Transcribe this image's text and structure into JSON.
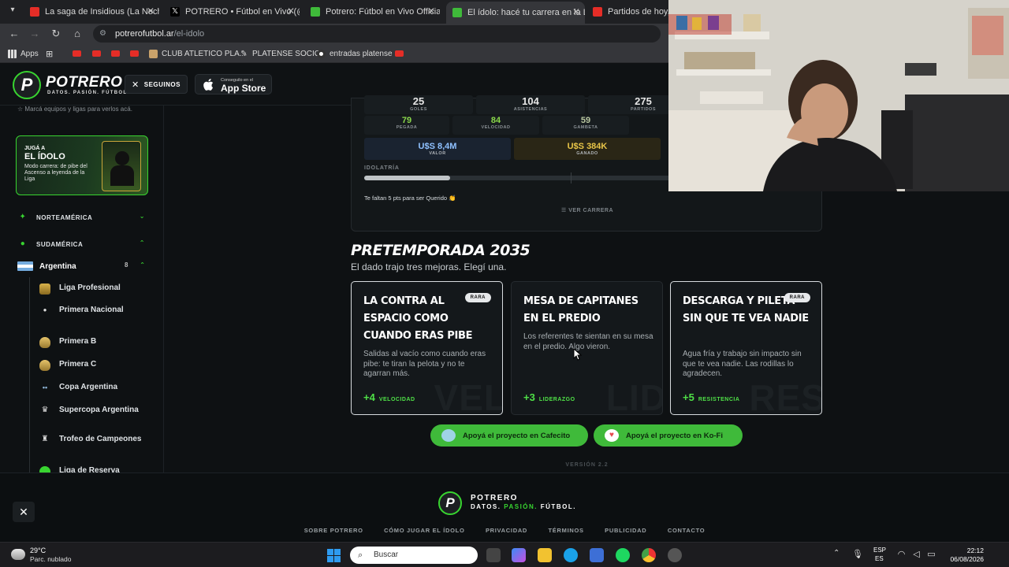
{
  "browser": {
    "tabs": [
      {
        "title": "La saga de Insidious (La Noche",
        "fav_color": "#e52d27"
      },
      {
        "title": "POTRERO • Fútbol en Vivo (@p",
        "fav_color": "#000000"
      },
      {
        "title": "Potrero: Fútbol en Vivo Official",
        "fav_color": "#3fba3a"
      },
      {
        "title": "El ídolo: hacé tu carrera en la L",
        "fav_color": "#3fba3a"
      },
      {
        "title": "Partidos de hoy, resu",
        "fav_color": "#e52d27"
      }
    ],
    "url_domain": "potrerofutbol.ar",
    "url_path": "/el-idolo",
    "bookmarks": [
      "Apps",
      "CLUB ATLETICO PLA...",
      "PLATENSE SOCIO",
      "entradas platense"
    ]
  },
  "header": {
    "logo_letter": "P",
    "logo_name": "POTRERO",
    "logo_tag": "DATOS. PASIÓN. FÚTBOL.",
    "follow_label": "SEGUINOS",
    "appstore_small": "Conseguilo en el",
    "appstore_big": "App Store"
  },
  "sidebar": {
    "hint": "Marcá equipos y ligas para verlos acá.",
    "promo": {
      "kicker": "JUGÁ A",
      "title": "EL ÍDOLO",
      "desc": "Modo carrera: de pibe del Ascenso a leyenda de la Liga"
    },
    "regions": [
      {
        "name": "NORTEAMÉRICA",
        "expanded": false
      },
      {
        "name": "SUDAMÉRICA",
        "expanded": true
      }
    ],
    "country": {
      "name": "Argentina",
      "count": "8"
    },
    "leagues": [
      "Liga Profesional",
      "Primera Nacional",
      "Primera B",
      "Primera C",
      "Copa Argentina",
      "Supercopa Argentina",
      "Trofeo de Campeones",
      "Liga de Reserva"
    ]
  },
  "career": {
    "stats": [
      {
        "value": "25",
        "label": "GOLES"
      },
      {
        "value": "104",
        "label": "ASISTENCIAS"
      },
      {
        "value": "275",
        "label": "PARTIDOS"
      }
    ],
    "attributes": [
      {
        "value": "79",
        "label": "PEGADA"
      },
      {
        "value": "84",
        "label": "VELOCIDAD"
      },
      {
        "value": "59",
        "label": "GAMBETA"
      }
    ],
    "value": {
      "amount": "U$S 8,4M",
      "label": "VALOR"
    },
    "earned": {
      "amount": "U$S 384K",
      "label": "GANADO"
    },
    "idolatry_label": "IDOLATRÍA",
    "idolatry_fraction": 0.28,
    "idolatry_msg": "Te faltan 5 pts para ser Querido 👏",
    "view_career": "VER CARRERA"
  },
  "preseason": {
    "title": "PRETEMPORADA 2035",
    "subtitle": "El dado trajo tres mejoras. Elegí una.",
    "options": [
      {
        "title": "LA CONTRA AL ESPACIO COMO CUANDO ERAS PIBE",
        "badge": "RARA",
        "desc": "Salidas al vacío como cuando eras pibe: te tiran la pelota y no te agarran más.",
        "bonus": "+4",
        "stat": "VELOCIDAD",
        "watermark": "VEL"
      },
      {
        "title": "MESA DE CAPITANES EN EL PREDIO",
        "badge": "",
        "desc": "Los referentes te sientan en su mesa en el predio. Algo vieron.",
        "bonus": "+3",
        "stat": "LIDERAZGO",
        "watermark": "LID"
      },
      {
        "title": "DESCARGA Y PILETA SIN QUE TE VEA NADIE",
        "badge": "RARA",
        "desc": "Agua fría y trabajo sin impacto sin que te vea nadie. Las rodillas lo agradecen.",
        "bonus": "+5",
        "stat": "RESISTENCIA",
        "watermark": "RES"
      }
    ]
  },
  "donate": {
    "cafecito": "Apoyá el proyecto en Cafecito",
    "kofi": "Apoyá el proyecto en Ko-Fi"
  },
  "version": "VERSIÓN 2.2",
  "footer": {
    "logo_letter": "P",
    "name": "POTRERO",
    "tag_a": "DATOS.",
    "tag_b": "PASIÓN.",
    "tag_c": "FÚTBOL.",
    "links": [
      "SOBRE POTRERO",
      "CÓMO JUGAR EL ÍDOLO",
      "PRIVACIDAD",
      "TÉRMINOS",
      "PUBLICIDAD",
      "CONTACTO"
    ]
  },
  "taskbar": {
    "temp": "29°C",
    "weather": "Parc. nublado",
    "search_placeholder": "Buscar",
    "lang_a": "ESP",
    "lang_b": "ES",
    "time": "22:12",
    "date": "06/08/2026"
  },
  "colors": {
    "accent": "#38d430",
    "donate_green": "#3fba3a",
    "bonus_green": "#4fe047",
    "gold_cell": "#2a2616",
    "gold_text": "#e8c548"
  }
}
